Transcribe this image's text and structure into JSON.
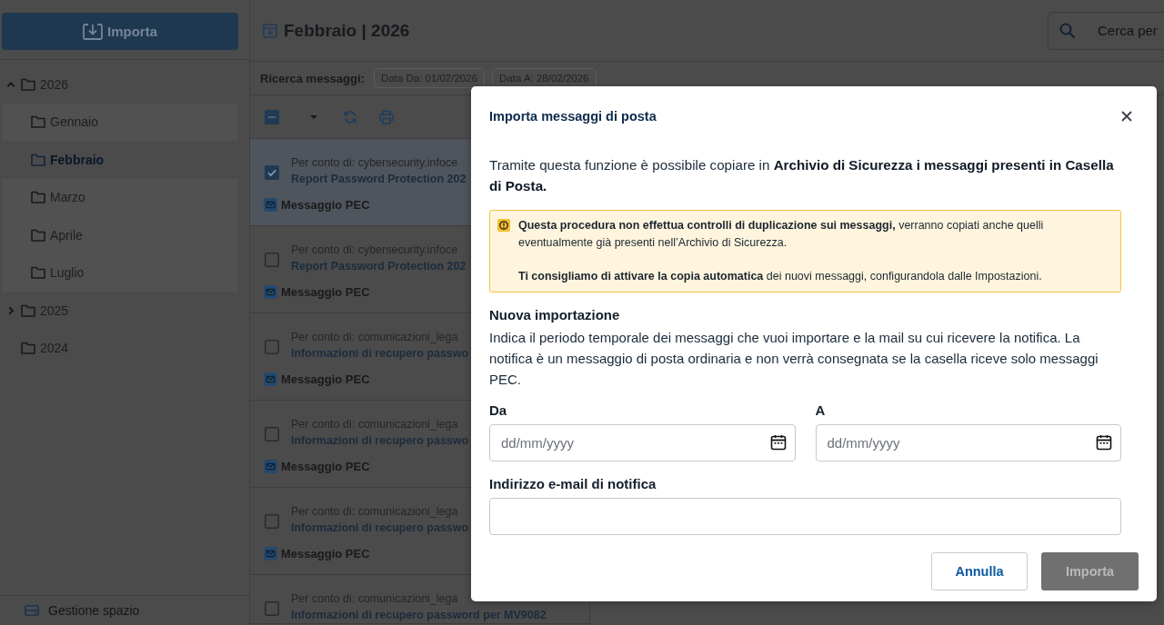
{
  "sidebar": {
    "import_button": "Importa",
    "tree": [
      {
        "label": "2026",
        "expandable": true,
        "expanded": true,
        "selected": false,
        "children": [
          {
            "label": "Gennaio",
            "selected": false
          },
          {
            "label": "Febbraio",
            "selected": true
          },
          {
            "label": "Marzo",
            "selected": false
          },
          {
            "label": "Aprile",
            "selected": false
          },
          {
            "label": "Luglio",
            "selected": false
          }
        ]
      },
      {
        "label": "2025",
        "expandable": true,
        "expanded": false,
        "selected": false
      },
      {
        "label": "2024",
        "expandable": false,
        "expanded": false,
        "selected": false
      }
    ],
    "footer": "Gestione spazio"
  },
  "header": {
    "title": "Febbraio | 2026",
    "search": {
      "placeholder": "Cerca per"
    }
  },
  "filter": {
    "label": "Ricerca messaggi:",
    "chips": [
      "Data Da: 01/02/2026",
      "Data A: 28/02/2026"
    ]
  },
  "toolbar": {
    "select_all": {
      "indeterminate": true
    }
  },
  "messages": [
    {
      "sender": "Per conto di: cybersecurity.infoce",
      "subject": "Report Password Protection 202",
      "tag": "Messaggio PEC",
      "checked": true,
      "selected": true
    },
    {
      "sender": "Per conto di: cybersecurity.infoce",
      "subject": "Report Password Protection 202",
      "tag": "Messaggio PEC",
      "checked": false,
      "selected": false
    },
    {
      "sender": "Per conto di: comunicazioni_lega",
      "subject": "Informazioni di recupero passwo",
      "tag": "Messaggio PEC",
      "checked": false,
      "selected": false
    },
    {
      "sender": "Per conto di: comunicazioni_lega",
      "subject": "Informazioni di recupero passwo",
      "tag": "Messaggio PEC",
      "checked": false,
      "selected": false
    },
    {
      "sender": "Per conto di: comunicazioni_lega",
      "subject": "Informazioni di recupero passwo",
      "tag": "Messaggio PEC",
      "checked": false,
      "selected": false
    },
    {
      "sender": "Per conto di: comunicazioni_lega",
      "subject": "Informazioni di recupero password per MV9082",
      "checked": false,
      "selected": false
    }
  ],
  "dialog": {
    "title": "Importa messaggi di posta",
    "intro": "Tramite questa funzione è possibile copiare in **Archivio di Sicurezza i messaggi presenti in Casella di Posta.**",
    "warning": [
      "**Questa procedura non effettua controlli di duplicazione sui messaggi,** verranno copiati anche quelli eventualmente già presenti nell’Archivio di Sicurezza.",
      "**Ti consigliamo di attivare la copia automatica** dei nuovi messaggi, configurandola dalle Impostazioni."
    ],
    "section_title": "Nuova importazione",
    "description": "Indica il periodo temporale dei messaggi che vuoi importare e la mail su cui ricevere la notifica. La notifica è un messaggio di posta ordinaria e non verrà consegnata se la casella riceve solo messaggi PEC.",
    "date_fields": [
      {
        "label": "Da",
        "placeholder": "dd/mm/yyyy"
      },
      {
        "label": "A",
        "placeholder": "dd/mm/yyyy"
      }
    ],
    "email": {
      "label": "Indirizzo e-mail di notifica"
    },
    "buttons": [
      {
        "label": "Annulla",
        "kind": "secondary",
        "disabled": false
      },
      {
        "label": "Importa",
        "kind": "primary",
        "disabled": true
      }
    ]
  }
}
